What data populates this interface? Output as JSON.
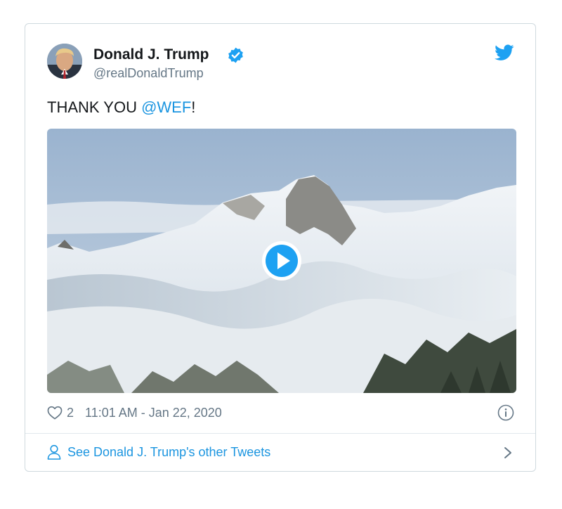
{
  "tweet": {
    "author_name": "Donald J. Trump",
    "handle": "@realDonaldTrump",
    "text_prefix": "THANK YOU ",
    "mention": "@WEF",
    "text_suffix": "!",
    "like_count": "2",
    "timestamp": "11:01 AM - Jan 22, 2020",
    "footer_link": "See Donald J. Trump's other Tweets"
  },
  "icons": {
    "verified": "verified-badge-icon",
    "brand": "twitter-bird-icon",
    "like": "heart-icon",
    "info": "info-icon",
    "profile": "person-icon",
    "chevron": "chevron-right-icon",
    "play": "play-icon"
  },
  "colors": {
    "accent": "#1b95e0",
    "text": "#14171a",
    "muted": "#657786",
    "border": "#cfd9de"
  }
}
